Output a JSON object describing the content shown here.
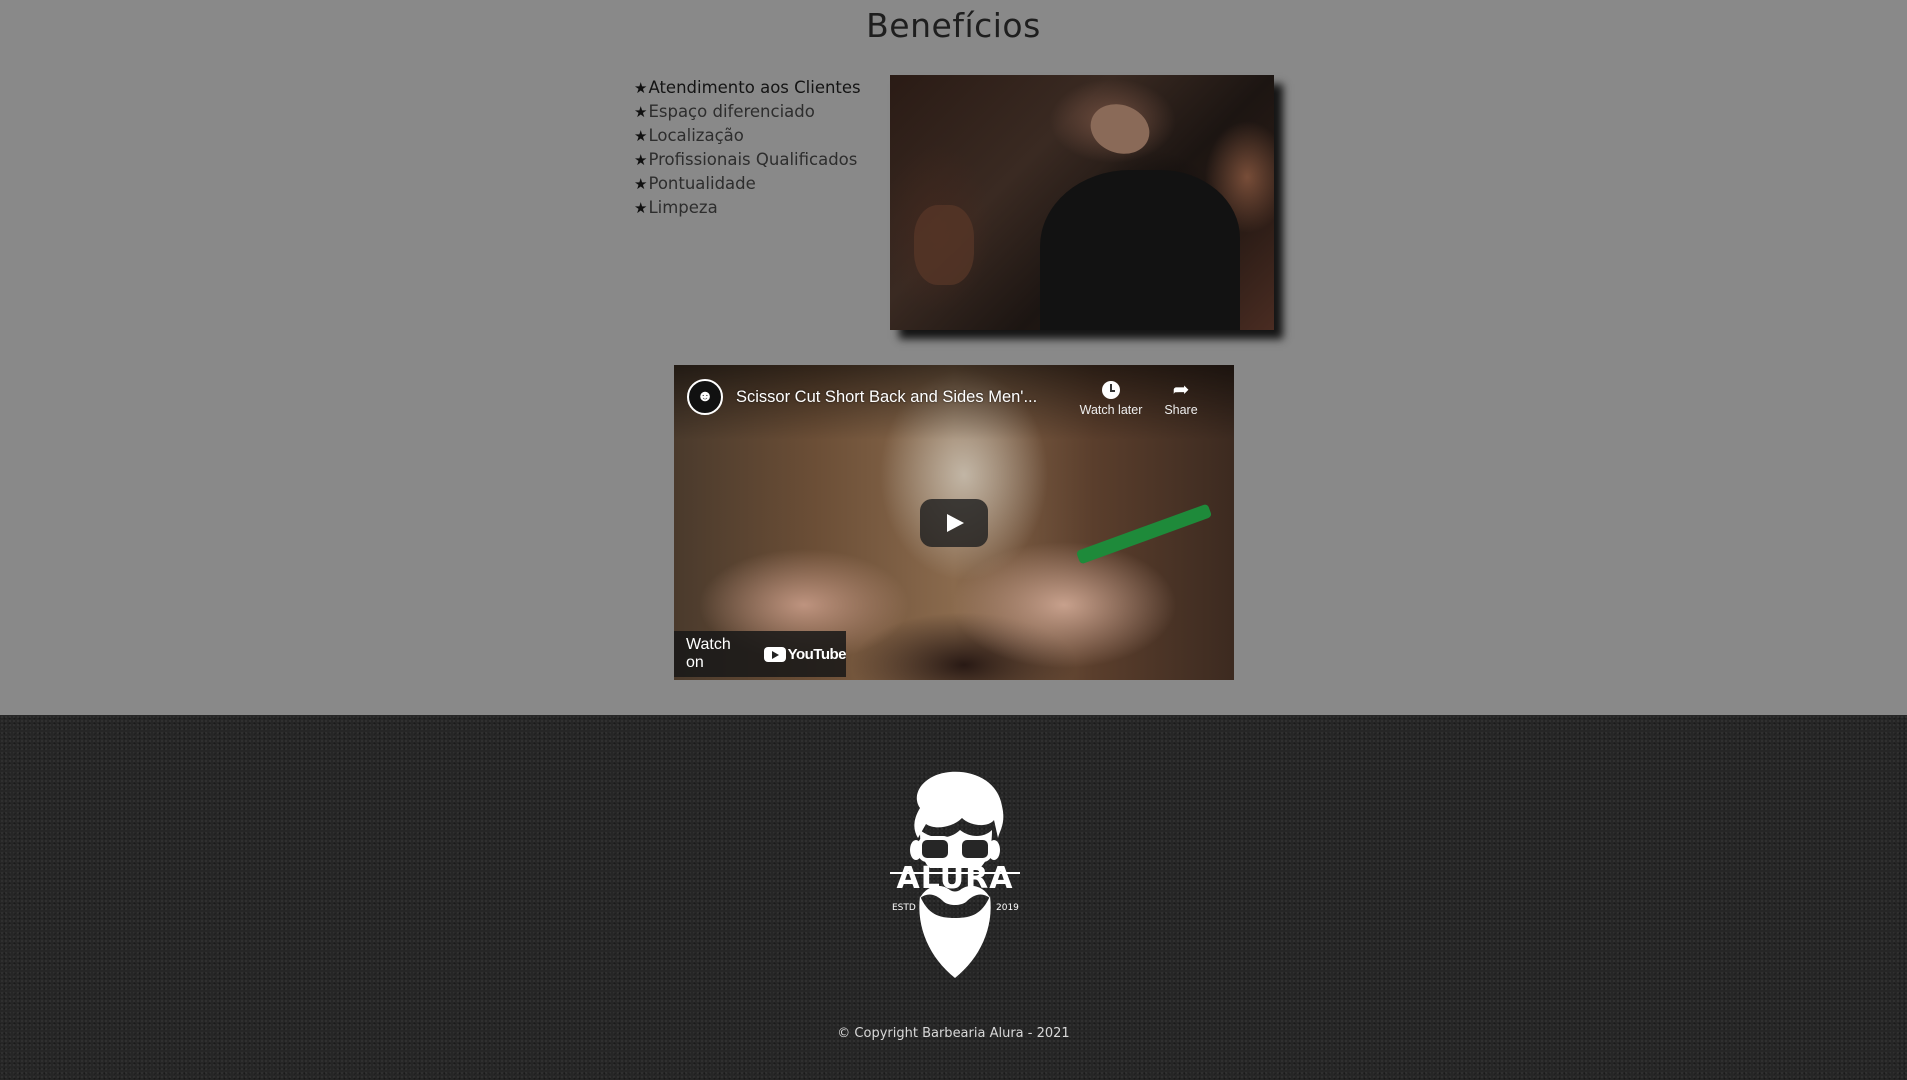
{
  "section": {
    "title": "Benefícios",
    "star_glyph": "★",
    "benefits": [
      "Atendimento aos Clientes",
      "Espaço diferenciado",
      "Localização",
      "Profissionais Qualificados",
      "Pontualidade",
      "Limpeza"
    ]
  },
  "video": {
    "title": "Scissor Cut Short Back and Sides Men'...",
    "watch_later": "Watch later",
    "share": "Share",
    "watch_on": "Watch on",
    "youtube": "YouTube"
  },
  "footer": {
    "logo_text": "ALURA",
    "logo_est": "ESTD",
    "logo_year": "2019",
    "copyright": "© Copyright Barbearia Alura - 2021"
  }
}
